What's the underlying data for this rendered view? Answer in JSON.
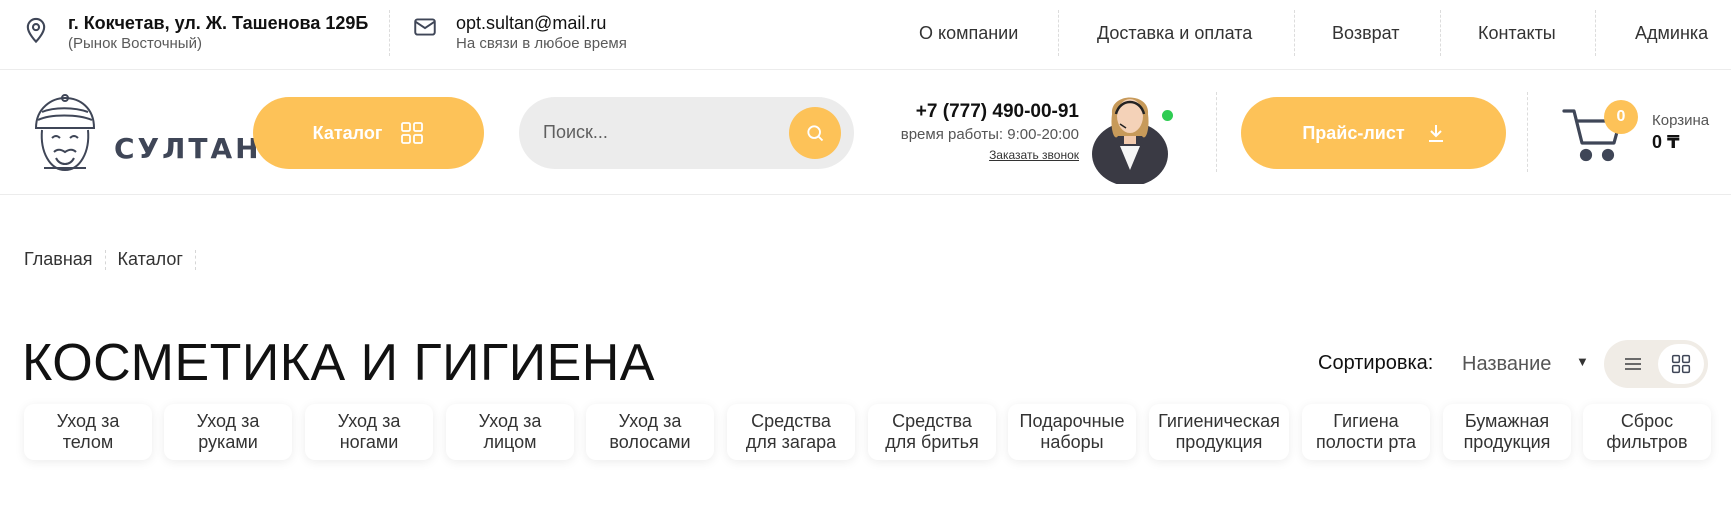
{
  "topbar": {
    "address": {
      "main": "г. Кокчетав, ул. Ж. Ташенова 129Б",
      "sub": "(Рынок Восточный)"
    },
    "email": {
      "main": "opt.sultan@mail.ru",
      "sub": "На связи в любое время"
    },
    "nav": [
      "О компании",
      "Доставка и оплата",
      "Возврат",
      "Контакты",
      "Админка"
    ]
  },
  "header": {
    "logo_text": "СУЛТАН",
    "catalog_label": "Каталог",
    "search_placeholder": "Поиск...",
    "phone": "+7 (777) 490-00-91",
    "hours": "время работы: 9:00-20:00",
    "call_link": "Заказать звонок",
    "price_label": "Прайс-лист",
    "cart": {
      "count": "0",
      "label": "Корзина",
      "total": "0 ₸"
    }
  },
  "breadcrumbs": [
    "Главная",
    "Каталог"
  ],
  "page": {
    "title": "КОСМЕТИКА И ГИГИЕНА",
    "sort_label": "Сортировка:",
    "sort_value": "Название",
    "sort_arrow": "▼"
  },
  "categories": [
    [
      "Уход за",
      "телом"
    ],
    [
      "Уход за",
      "руками"
    ],
    [
      "Уход за",
      "ногами"
    ],
    [
      "Уход за",
      "лицом"
    ],
    [
      "Уход за",
      "волосами"
    ],
    [
      "Средства",
      "для загара"
    ],
    [
      "Средства",
      "для бритья"
    ],
    [
      "Подарочные",
      "наборы"
    ],
    [
      "Гигиеническая",
      "продукция"
    ],
    [
      "Гигиена",
      "полости рта"
    ],
    [
      "Бумажная",
      "продукция"
    ],
    [
      "Сброс",
      "фильтров"
    ]
  ],
  "colors": {
    "accent": "#fdc258",
    "dark": "#3f4657",
    "online": "#2ecc52"
  },
  "icons": [
    "location-pin-icon",
    "mail-icon",
    "grid-icon",
    "search-icon",
    "download-icon",
    "cart-icon",
    "list-view-icon",
    "grid-view-icon"
  ]
}
